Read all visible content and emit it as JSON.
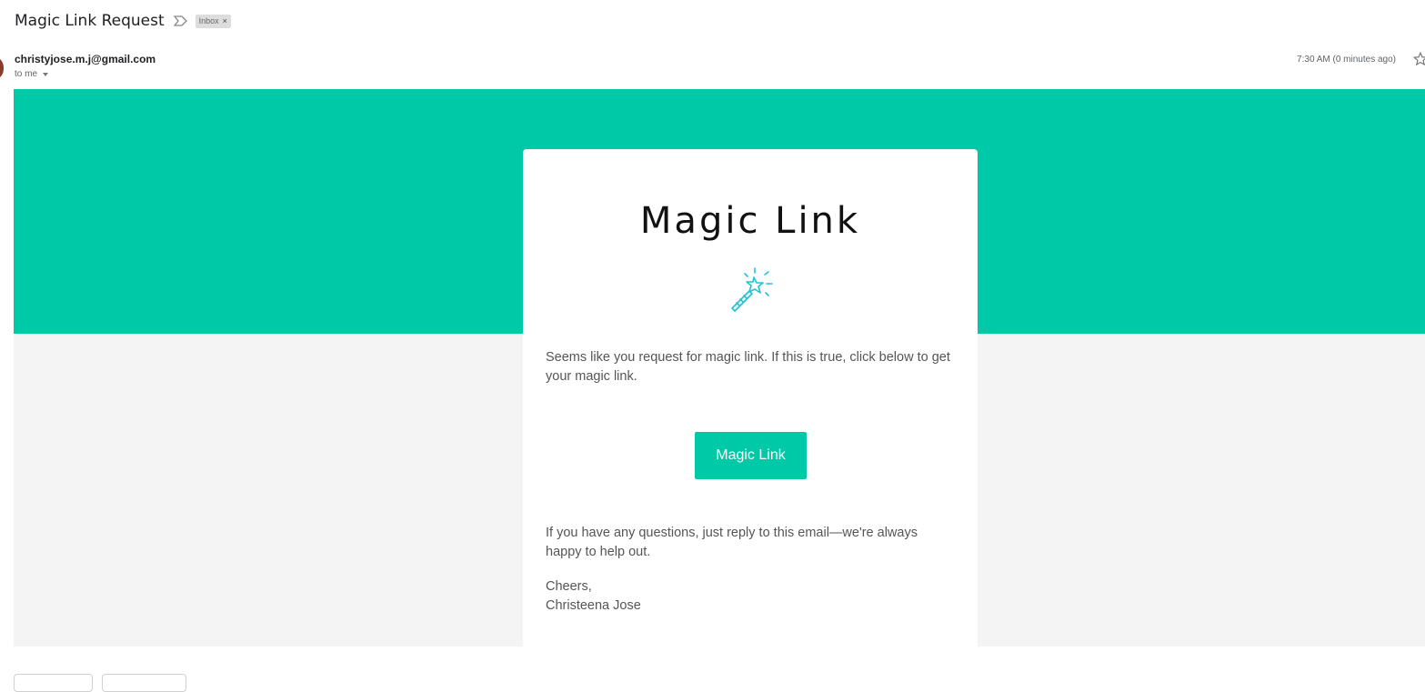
{
  "subject": {
    "title": "Magic Link Request",
    "importance_icon": "importance-marker-icon",
    "label": "Inbox",
    "label_remove": "×"
  },
  "sender": {
    "email": "christyjose.m.j@gmail.com",
    "recipient_line": "to me",
    "timestamp": "7:30 AM (0 minutes ago)",
    "avatar_color": "#8b3a2e"
  },
  "email": {
    "heading": "Magic Link",
    "icon": "magic-wand-icon",
    "intro": "Seems like you request for magic link. If this is true, click below to get your magic link.",
    "button_label": "Magic Link",
    "help": "If you have any questions, just reply to this email—we're always happy to help out.",
    "closing": "Cheers,",
    "signature": "Christeena Jose",
    "brand_color": "#00c9a7",
    "background_color": "#f4f4f4"
  }
}
